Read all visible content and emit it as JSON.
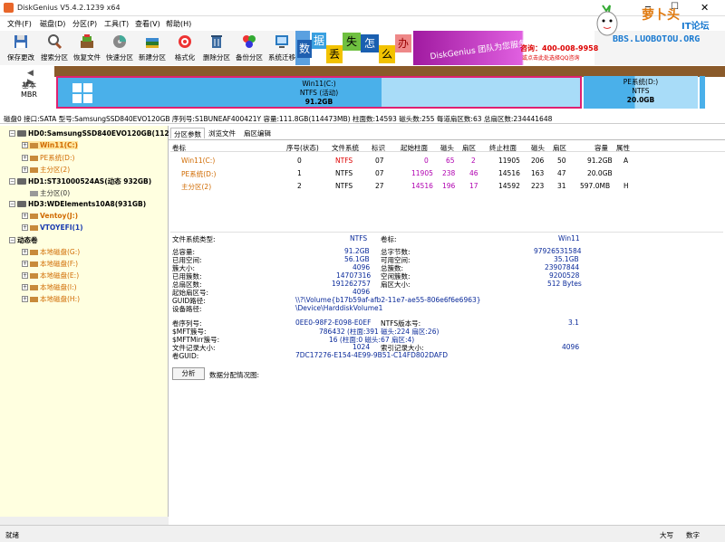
{
  "window": {
    "title": "DiskGenius V5.4.2.1239 x64"
  },
  "menu": [
    "文件(F)",
    "磁盘(D)",
    "分区(P)",
    "工具(T)",
    "查看(V)",
    "帮助(H)"
  ],
  "toolbar": [
    {
      "label": "保存更改",
      "icon": "save-icon"
    },
    {
      "label": "搜索分区",
      "icon": "search-icon"
    },
    {
      "label": "恢复文件",
      "icon": "recover-icon"
    },
    {
      "label": "快速分区",
      "icon": "quick-partition-icon"
    },
    {
      "label": "新建分区",
      "icon": "new-partition-icon"
    },
    {
      "label": "格式化",
      "icon": "format-icon"
    },
    {
      "label": "删除分区",
      "icon": "delete-icon"
    },
    {
      "label": "备份分区",
      "icon": "backup-icon"
    },
    {
      "label": "系统迁移",
      "icon": "migrate-icon"
    }
  ],
  "banner": {
    "tiles": [
      "数",
      "据",
      "丢",
      "失",
      "怎",
      "么",
      "办"
    ],
    "slogan": "DiskGenius 团队为您服务",
    "phone": "咨询：400-008-9958",
    "sub": "或点击此处选择QQ咨询",
    "brand": "萝卜头",
    "brand2": "IT论坛",
    "url": "BBS.LUOBOTOU.ORG"
  },
  "disk_map": {
    "label_line1": "基本",
    "label_line2": "MBR",
    "main": {
      "name": "Win11(C:)",
      "fs": "NTFS (活动)",
      "size": "91.2GB"
    },
    "side": {
      "name": "PE系统(D:)",
      "fs": "NTFS",
      "size": "20.0GB"
    }
  },
  "disk_info": "磁盘0 接口:SATA  型号:SamsungSSD840EVO120GB  序列号:S1BUNEAF400421Y  容量:111.8GB(114473MB)  柱面数:14593  磁头数:255  每道扇区数:63  总扇区数:234441648",
  "tree": [
    {
      "label": "HD0:SamsungSSD840EVO120GB(112",
      "type": "disk",
      "bold": true,
      "color": "#000"
    },
    {
      "label": "Win11(C:)",
      "type": "part",
      "bold": true,
      "color": "#d06a00",
      "sel": true
    },
    {
      "label": "PE系统(D:)",
      "type": "part",
      "bold": false,
      "color": "#d06a00"
    },
    {
      "label": "主分区(2)",
      "type": "part",
      "bold": false,
      "color": "#d06a00"
    },
    {
      "label": "HD1:ST31000524AS(动态 932GB)",
      "type": "disk",
      "bold": true,
      "color": "#000"
    },
    {
      "label": "主分区(0)",
      "type": "part",
      "bold": false,
      "color": "#333"
    },
    {
      "label": "HD3:WDElements10A8(931GB)",
      "type": "disk",
      "bold": true,
      "color": "#000"
    },
    {
      "label": "Ventoy(J:)",
      "type": "part",
      "bold": true,
      "color": "#d06a00"
    },
    {
      "label": "VTOYEFI(1)",
      "type": "part",
      "bold": true,
      "color": "#1a3bb0"
    },
    {
      "label": "动态卷",
      "type": "group",
      "bold": true,
      "color": "#000"
    },
    {
      "label": "本地磁盘(G:)",
      "type": "part",
      "bold": false,
      "color": "#d06a00"
    },
    {
      "label": "本地磁盘(F:)",
      "type": "part",
      "bold": false,
      "color": "#d06a00"
    },
    {
      "label": "本地磁盘(E:)",
      "type": "part",
      "bold": false,
      "color": "#d06a00"
    },
    {
      "label": "本地磁盘(I:)",
      "type": "part",
      "bold": false,
      "color": "#d06a00"
    },
    {
      "label": "本地磁盘(H:)",
      "type": "part",
      "bold": false,
      "color": "#d06a00"
    }
  ],
  "tabs": [
    "分区参数",
    "浏览文件",
    "扇区编辑"
  ],
  "table": {
    "headers": [
      "卷标",
      "序号(状态)",
      "文件系统",
      "标识",
      "起始柱面",
      "磁头",
      "扇区",
      "终止柱面",
      "磁头",
      "扇区",
      "容量",
      "属性"
    ],
    "rows": [
      [
        "Win11(C:)",
        "0",
        "NTFS",
        "07",
        "0",
        "65",
        "2",
        "11905",
        "206",
        "50",
        "91.2GB",
        "A"
      ],
      [
        "PE系统(D:)",
        "1",
        "NTFS",
        "07",
        "11905",
        "238",
        "46",
        "14516",
        "163",
        "47",
        "20.0GB",
        ""
      ],
      [
        "主分区(2)",
        "2",
        "NTFS",
        "27",
        "14516",
        "196",
        "17",
        "14592",
        "223",
        "31",
        "597.0MB",
        "H"
      ]
    ]
  },
  "details": {
    "fs_type_label": "文件系统类型:",
    "fs_type": "NTFS",
    "vol_label_label": "卷标:",
    "vol_label": "Win11",
    "left": [
      [
        "总容量:",
        "91.2GB"
      ],
      [
        "已用空间:",
        "56.1GB"
      ],
      [
        "簇大小:",
        "4096"
      ],
      [
        "已用簇数:",
        "14707316"
      ],
      [
        "总扇区数:",
        "191262757"
      ],
      [
        "起始扇区号:",
        "4096"
      ]
    ],
    "right": [
      [
        "总字节数:",
        "97926531584"
      ],
      [
        "可用空间:",
        "35.1GB"
      ],
      [
        "总簇数:",
        "23907844"
      ],
      [
        "空闲簇数:",
        "9200528"
      ],
      [
        "扇区大小:",
        "512 Bytes"
      ]
    ],
    "guid_path_label": "GUID路径:",
    "guid_path": "\\\\?\\Volume{b17b59af-afb2-11e7-ae55-806e6f6e6963}",
    "device_path_label": "设备路径:",
    "device_path": "\\Device\\HarddiskVolume1",
    "serial_label": "卷序列号:",
    "serial": "0EE0-98F2-E098-E0EF",
    "ntfs_ver_label": "NTFS版本号:",
    "ntfs_ver": "3.1",
    "mft_label": "$MFT簇号:",
    "mft": "786432 (柱面:391 磁头:224 扇区:26)",
    "mftmirr_label": "$MFTMirr簇号:",
    "mftmirr": "16 (柱面:0 磁头:67 扇区:4)",
    "rec_label": "文件记录大小:",
    "rec": "1024",
    "idx_label": "索引记录大小:",
    "idx": "4096",
    "volguid_label": "卷GUID:",
    "volguid": "7DC17276-E154-4E99-9B51-C14FD802DAFD",
    "analyze_button": "分析",
    "alloc_label": "数据分配情况图:"
  },
  "status": {
    "left": "就绪",
    "caps": "大写",
    "num": "数字"
  }
}
